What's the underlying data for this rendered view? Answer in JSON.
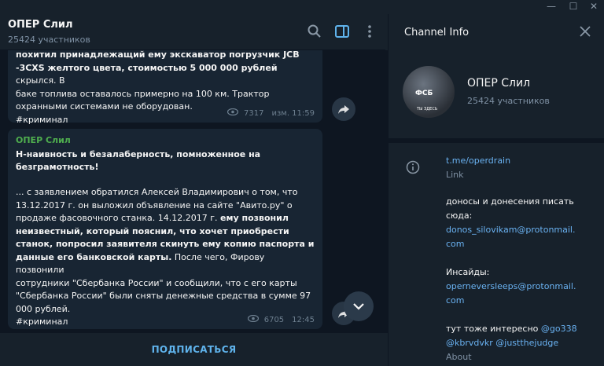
{
  "window": {
    "minimize": "—",
    "maximize": "☐",
    "close": "✕"
  },
  "chat": {
    "title": "ОПЕР Слил",
    "subtitle": "25424 участников"
  },
  "message1": {
    "line1": "похитил принадлежащий ему экскаватор погрузчик JCB",
    "line2": "-3CXS желтого цвета, стоимостью 5 000 000 рублей",
    "line2b": " скрылся. В",
    "line3": "баке топлива оставалось примерно на 100 км. Трактор",
    "line4": "охранными системами не оборудован.",
    "hashtag": "#криминал",
    "views": "7317",
    "time": "изм. 11:59"
  },
  "message2": {
    "author": "ОПЕР Слил",
    "headline1": "Н-наивность и безалаберность, помноженное на",
    "headline2": "безграмотность!",
    "l1": "... с заявлением обратился Алексей Владимирович  о том, что",
    "l2": "13.12.2017 г. он выложил объявление на сайте \"Авито.ру\" о",
    "l3a": "продаже фасовочного станка. 14.12.2017 г. ",
    "l3b": "ему позвонил",
    "l4": "неизвестный, который пояснил, что хочет приобрести",
    "l5": "станок, попросил заявителя скинуть ему копию паспорта и",
    "l6a": "данные его банковской карты.",
    "l6b": " После чего, Фирову позвонили",
    "l7": "сотрудники \"Сбербанка России\" и сообщили, что с его карты",
    "l8": "\"Сбербанка России\" были сняты денежные средства  в сумме 97",
    "l9": "000 рублей.",
    "hashtag": "#криминал",
    "views": "6705",
    "time": "12:45"
  },
  "subscribe_label": "ПОДПИСАТЬСЯ",
  "info_panel": {
    "title": "Channel Info",
    "avatar_text": "ФСБ",
    "avatar_caption": "ТЫ ЗДЕСЬ",
    "name": "ОПЕР Слил",
    "members": "25424 участников",
    "link": "t.me/operdrain",
    "link_label": "Link",
    "desc1": "доносы и донесения писать",
    "desc2": "сюда:",
    "email1a": "donos_silovikam@protonmail.",
    "email1b": "com",
    "insides": "Инсайды:",
    "email2a": "operneversleeps@protonmail.",
    "email2b": "com",
    "also": " тут тоже интересно ",
    "handle1": "@go338",
    "handle2": "@kbrvdvkr",
    "handle3": "@justthejudge",
    "about_label": "About"
  }
}
